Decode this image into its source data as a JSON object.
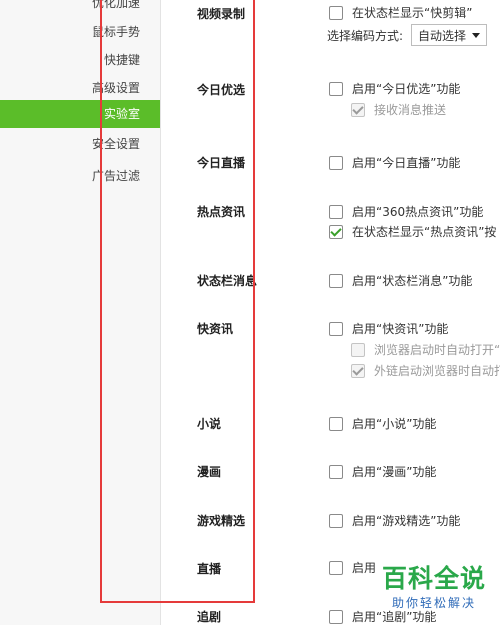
{
  "sidebar": {
    "items": [
      {
        "label": "优化加速"
      },
      {
        "label": "鼠标手势"
      },
      {
        "label": "快捷键"
      },
      {
        "label": "高级设置"
      },
      {
        "label": "实验室"
      },
      {
        "label": "安全设置"
      },
      {
        "label": "广告过滤"
      }
    ],
    "active_index": 4
  },
  "sections": {
    "video": {
      "title": "视频录制",
      "opt1": "在状态栏显示“快剪辑”",
      "encode_label": "选择编码方式:",
      "encode_value": "自动选择"
    },
    "today_pick": {
      "title": "今日优选",
      "opt1": "启用“今日优选”功能",
      "opt2": "接收消息推送"
    },
    "today_live": {
      "title": "今日直播",
      "opt1": "启用“今日直播”功能"
    },
    "hot_news": {
      "title": "热点资讯",
      "opt1": "启用“360热点资讯”功能",
      "opt2": "在状态栏显示“热点资讯”按"
    },
    "status_msg": {
      "title": "状态栏消息",
      "opt1": "启用“状态栏消息”功能"
    },
    "quick_news": {
      "title": "快资讯",
      "opt1": "启用“快资讯”功能",
      "opt2": "浏览器启动时自动打开“",
      "opt3": "外链启动浏览器时自动打开"
    },
    "novel": {
      "title": "小说",
      "opt1": "启用“小说”功能"
    },
    "comic": {
      "title": "漫画",
      "opt1": "启用“漫画”功能"
    },
    "games": {
      "title": "游戏精选",
      "opt1": "启用“游戏精选”功能"
    },
    "live": {
      "title": "直播",
      "opt1": "启用"
    },
    "drama": {
      "title": "追剧",
      "opt1": "启用“追剧”功能"
    }
  },
  "watermark": {
    "main": "百科全说",
    "sub": "助你轻松解决"
  },
  "colors": {
    "active_sidebar": "#5bbd29",
    "highlight_frame": "#e53a3a",
    "checkmark": "#3aa02a",
    "watermark_main": "#2aa84a",
    "watermark_sub": "#2f6bb8"
  }
}
